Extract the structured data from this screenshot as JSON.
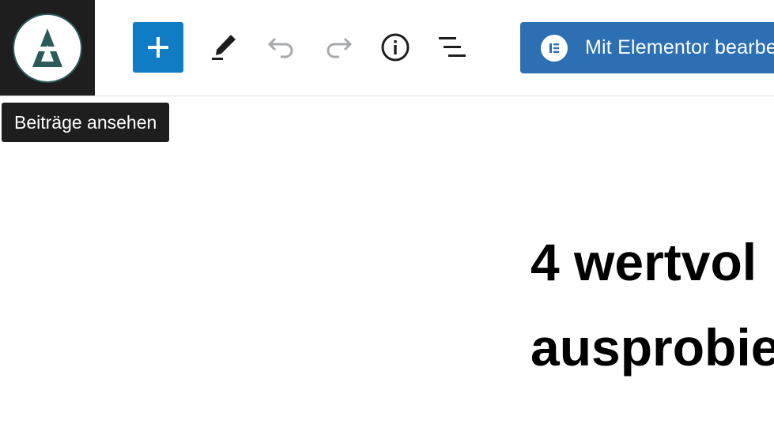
{
  "toolbar": {
    "site_logo_icon": "site-logo-triangle-icon",
    "add_block_icon": "plus-icon",
    "tools_icon": "pencil-icon",
    "undo_icon": "undo-arrow-icon",
    "redo_icon": "redo-arrow-icon",
    "details_icon": "info-circle-icon",
    "outline_icon": "list-view-icon",
    "elementor_button": {
      "label": "Mit Elementor bearbeiten",
      "icon": "elementor-logo-icon",
      "color": "#2c6fb3"
    },
    "accent_color": "#0f7cc4",
    "logo_color": "#2a5b5a"
  },
  "tooltip": {
    "text": "Beiträge ansehen"
  },
  "post": {
    "title_lines": [
      "4 wertvol",
      "ausprobie"
    ]
  }
}
